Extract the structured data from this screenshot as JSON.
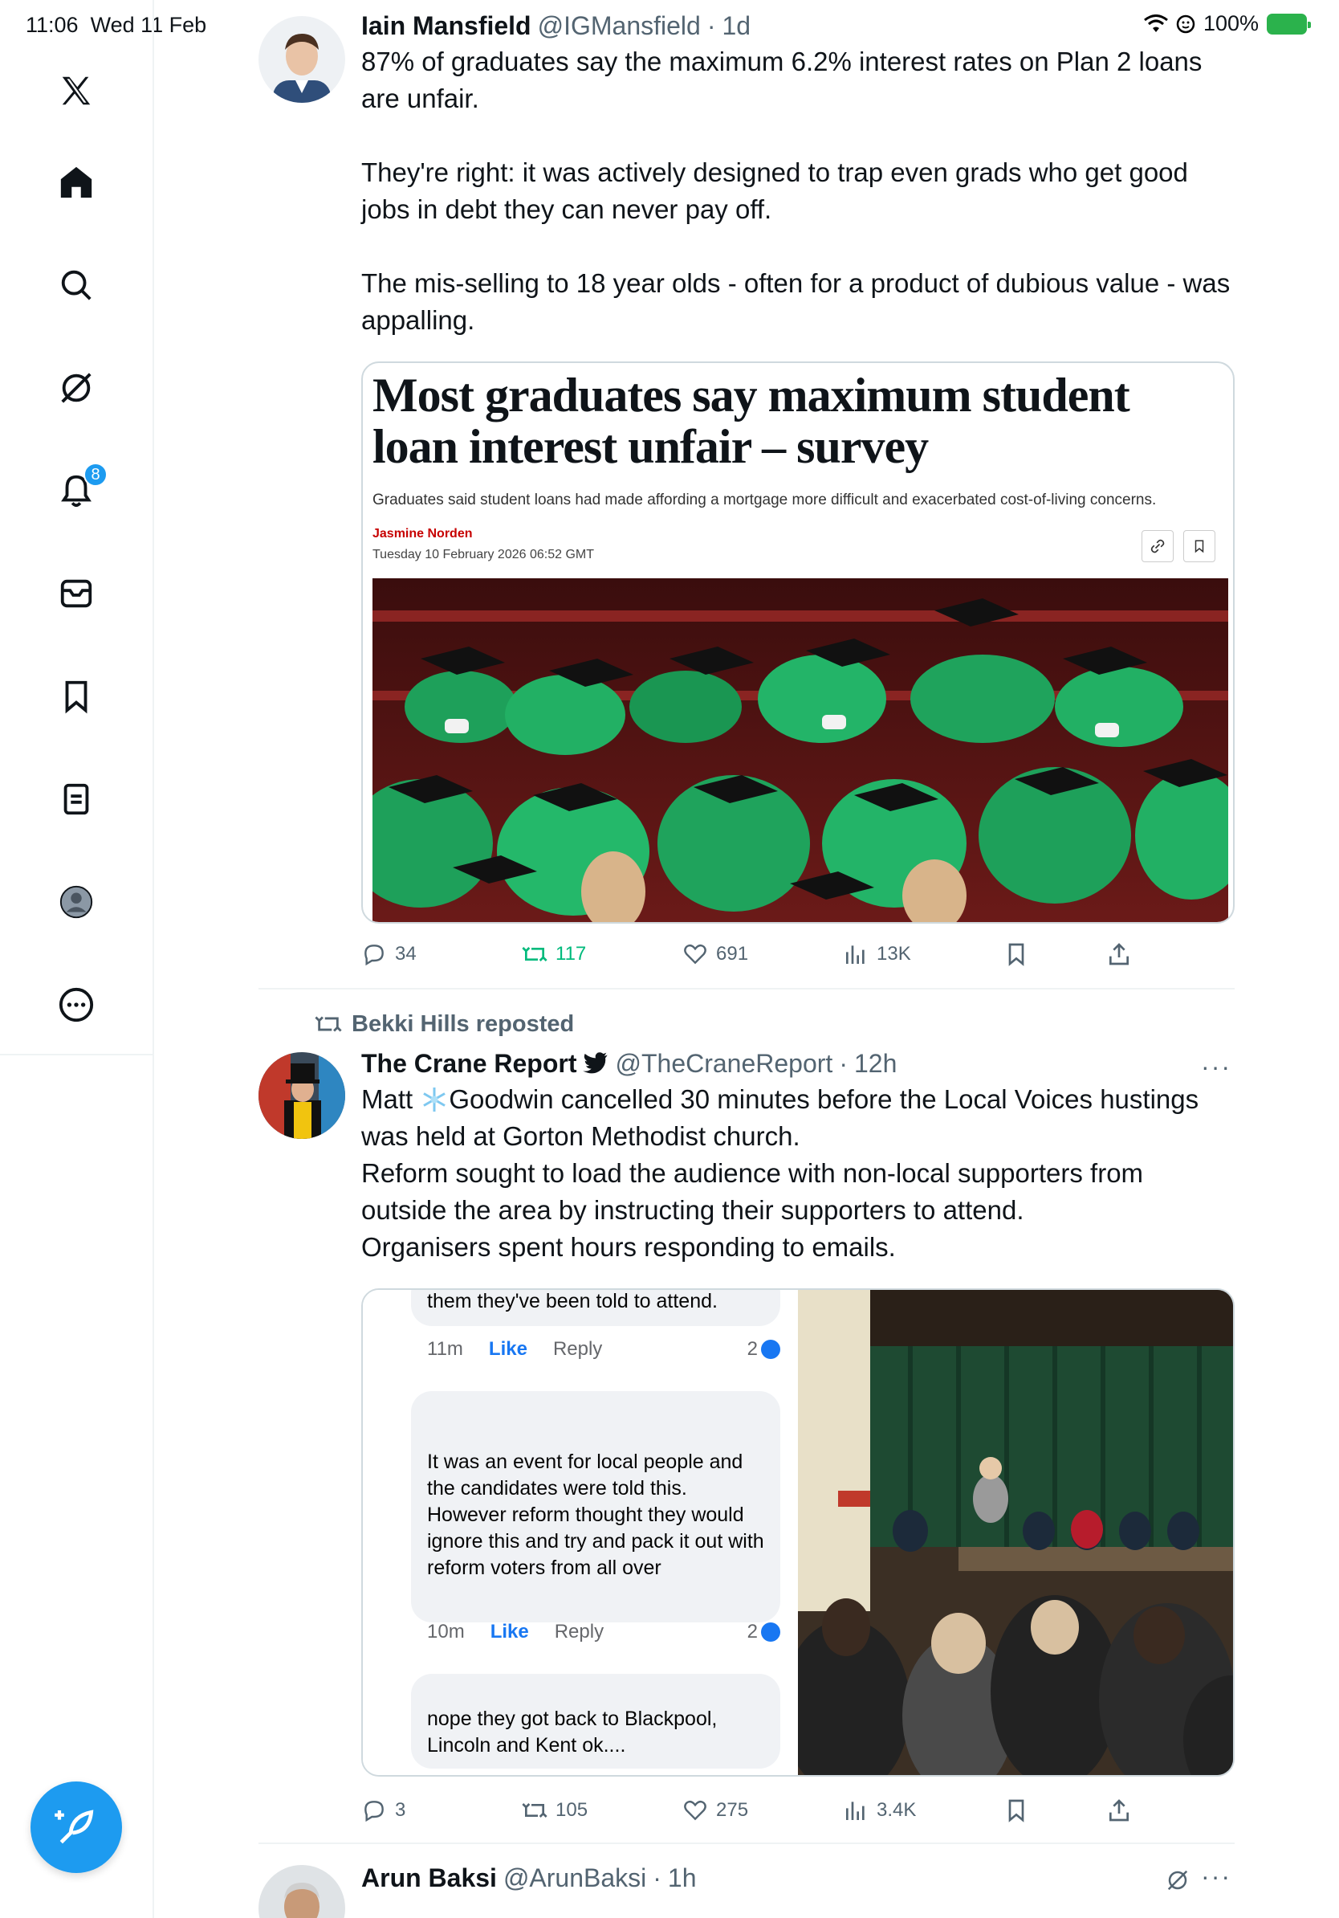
{
  "status_bar": {
    "time": "11:06",
    "date": "Wed 11 Feb",
    "battery": "100%",
    "battery_color": "#2bb24c"
  },
  "sidebar": {
    "notifications_badge": "8",
    "items": [
      "x-logo-icon",
      "home-icon",
      "search-icon",
      "grok-icon",
      "notifications-icon",
      "messages-icon",
      "bookmarks-icon",
      "lists-icon",
      "profile-icon",
      "more-icon"
    ]
  },
  "tweets": [
    {
      "name": "Iain Mansfield",
      "handle": "@IGMansfield",
      "dot": "·",
      "time": "1d",
      "text": "87% of graduates say the maximum 6.2% interest rates on Plan 2 loans are unfair.\n\nThey're right: it was actively designed to trap even grads who get good jobs in debt they can never pay off.\n\nThe mis-selling to 18 year olds - often for a product of dubious value - was appalling.",
      "card": {
        "headline": "Most graduates say maximum student loan interest unfair – survey",
        "standfirst": "Graduates said student loans had made affording a mortgage more difficult and exacerbated cost-of-living concerns.",
        "author": "Jasmine Norden",
        "date": "Tuesday 10 February 2026 06:52 GMT"
      },
      "replies": "34",
      "reposts": "117",
      "likes": "691",
      "views": "13K"
    },
    {
      "reposted_by": "Bekki Hills reposted",
      "name": "The Crane Report",
      "handle": "@TheCraneReport",
      "dot": "·",
      "time": "12h",
      "more": "···",
      "text_prefix": "Matt",
      "text": "Goodwin cancelled 30 minutes before the Local Voices hustings was held at Gorton Methodist church.\nReform sought to load the audience with non-local supporters from outside the area by instructing their supporters to attend.\nOrganisers spent hours responding to emails.",
      "media_comments": [
        {
          "text": "them they've been told to attend.",
          "time": "11m",
          "like": "Like",
          "reply": "Reply",
          "count": "2"
        },
        {
          "text": "It was an event for local people and the candidates were told this. However reform thought they would ignore this and try and pack it out with reform voters from all over",
          "time": "10m",
          "like": "Like",
          "reply": "Reply",
          "count": "2"
        },
        {
          "text": "nope they got back to Blackpool, Lincoln and Kent ok....",
          "time": "",
          "like": "",
          "reply": "",
          "count": ""
        }
      ],
      "replies": "3",
      "reposts": "105",
      "likes": "275",
      "views": "3.4K"
    },
    {
      "name": "Arun Baksi",
      "handle": "@ArunBaksi",
      "dot": "·",
      "time": "1h",
      "more": "···"
    }
  ],
  "colors": {
    "accent": "#1d9bf0",
    "secondary_text": "#536471",
    "repost_green": "#00ba7c",
    "divider": "#eff3f4"
  }
}
